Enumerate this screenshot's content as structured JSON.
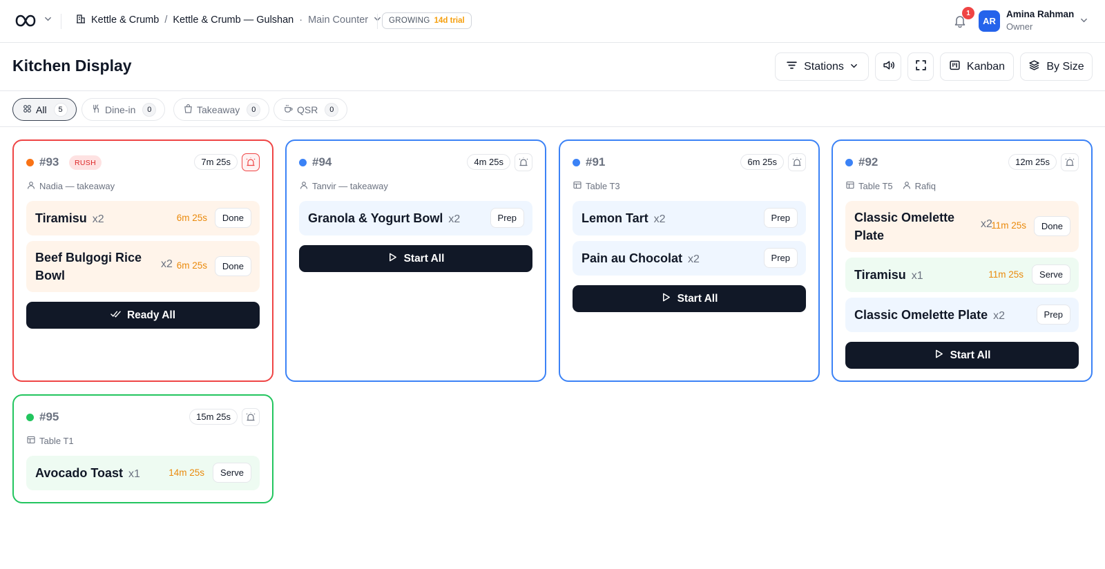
{
  "topbar": {
    "org": "Kettle & Crumb",
    "sep": "/",
    "branch": "Kettle & Crumb — Gulshan",
    "dot": "·",
    "counter": "Main Counter",
    "plan": "GROWING",
    "trial": "14d trial",
    "notifications": "1",
    "user_initials": "AR",
    "user_name": "Amina Rahman",
    "user_role": "Owner"
  },
  "header": {
    "title": "Kitchen Display",
    "stations_label": "Stations",
    "kanban_label": "Kanban",
    "by_size_label": "By Size"
  },
  "filters": [
    {
      "label": "All",
      "count": "5"
    },
    {
      "label": "Dine-in",
      "count": "0"
    },
    {
      "label": "Takeaway",
      "count": "0"
    },
    {
      "label": "QSR",
      "count": "0"
    }
  ],
  "colors": {
    "rush": "#ef4444",
    "new": "#3b82f6",
    "ready": "#22c55e",
    "dot_orange": "#f97316",
    "timer_orange": "#ea8a0c"
  },
  "orders": [
    {
      "number": "#93",
      "badge": "RUSH",
      "timer": "7m 25s",
      "meta": "Nadia — takeaway",
      "items": [
        {
          "name": "Tiramisu",
          "qty": "x2",
          "time": "6m 25s",
          "action": "Done"
        },
        {
          "name": "Beef Bulgogi Rice Bowl",
          "qty": "x2",
          "time": "6m 25s",
          "action": "Done"
        }
      ],
      "cta": "Ready All"
    },
    {
      "number": "#94",
      "timer": "4m 25s",
      "meta": "Tanvir — takeaway",
      "items": [
        {
          "name": "Granola & Yogurt Bowl",
          "qty": "x2",
          "action": "Prep"
        }
      ],
      "cta": "Start All"
    },
    {
      "number": "#91",
      "timer": "6m 25s",
      "meta": "Table T3",
      "items": [
        {
          "name": "Lemon Tart",
          "qty": "x2",
          "action": "Prep"
        },
        {
          "name": "Pain au Chocolat",
          "qty": "x2",
          "action": "Prep"
        }
      ],
      "cta": "Start All"
    },
    {
      "number": "#92",
      "timer": "12m 25s",
      "meta": "Table T5",
      "meta2": "Rafiq",
      "items": [
        {
          "name": "Classic Omelette Plate",
          "qty": "x2",
          "time": "11m 25s",
          "action": "Done"
        },
        {
          "name": "Tiramisu",
          "qty": "x1",
          "time": "11m 25s",
          "action": "Serve"
        },
        {
          "name": "Classic Omelette Plate",
          "qty": "x2",
          "action": "Prep"
        }
      ],
      "cta": "Start All"
    },
    {
      "number": "#95",
      "timer": "15m 25s",
      "meta": "Table T1",
      "items": [
        {
          "name": "Avocado Toast",
          "qty": "x1",
          "time": "14m 25s",
          "action": "Serve"
        }
      ]
    }
  ]
}
